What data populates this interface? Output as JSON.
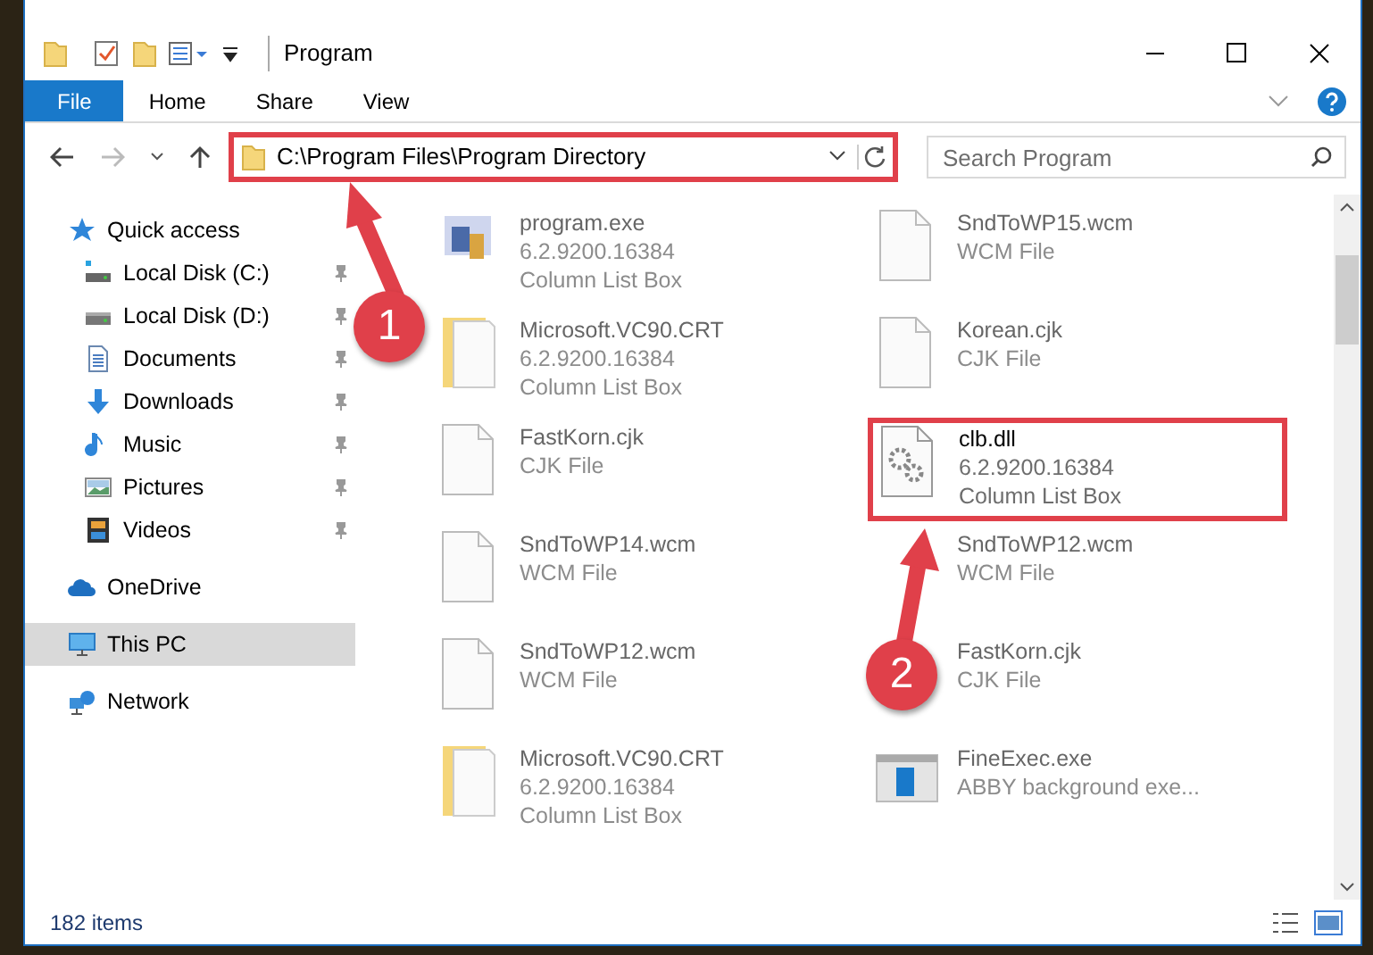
{
  "window": {
    "title": "Program"
  },
  "ribbon_tabs": [
    {
      "label": "File",
      "selected": true
    },
    {
      "label": "Home",
      "selected": false
    },
    {
      "label": "Share",
      "selected": false
    },
    {
      "label": "View",
      "selected": false
    }
  ],
  "address_bar": {
    "path": "C:\\Program Files\\Program Directory",
    "highlighted": true
  },
  "search": {
    "placeholder": "Search Program"
  },
  "sidebar": {
    "items": [
      {
        "label": "Quick access",
        "kind": "quick",
        "selected": false,
        "children": [
          {
            "label": "Local Disk (C:)",
            "kind": "disk-c",
            "pinned": true,
            "selected": false
          },
          {
            "label": "Local Disk (D:)",
            "kind": "disk",
            "pinned": true,
            "selected": false
          },
          {
            "label": "Documents",
            "kind": "documents",
            "pinned": true,
            "selected": false
          },
          {
            "label": "Downloads",
            "kind": "downloads",
            "pinned": true,
            "selected": false
          },
          {
            "label": "Music",
            "kind": "music",
            "pinned": true,
            "selected": false
          },
          {
            "label": "Pictures",
            "kind": "pictures",
            "pinned": true,
            "selected": false
          },
          {
            "label": "Videos",
            "kind": "videos",
            "pinned": true,
            "selected": false
          }
        ]
      },
      {
        "label": "OneDrive",
        "kind": "cloud",
        "selected": false
      },
      {
        "label": "This PC",
        "kind": "pc",
        "selected": true
      },
      {
        "label": "Network",
        "kind": "network",
        "selected": false
      }
    ]
  },
  "files": [
    {
      "name": "program.exe",
      "lines": [
        "6.2.9200.16384",
        "Column List Box"
      ],
      "kind": "exe",
      "blurred": true,
      "highlighted": false
    },
    {
      "name": "SndToWP15.wcm",
      "lines": [
        "WCM File"
      ],
      "kind": "file",
      "blurred": true,
      "highlighted": false
    },
    {
      "name": "Microsoft.VC90.CRT",
      "lines": [
        "6.2.9200.16384",
        "Column List Box"
      ],
      "kind": "manifest",
      "blurred": true,
      "highlighted": false
    },
    {
      "name": "Korean.cjk",
      "lines": [
        "CJK File"
      ],
      "kind": "file",
      "blurred": true,
      "highlighted": false
    },
    {
      "name": "FastKorn.cjk",
      "lines": [
        "CJK File"
      ],
      "kind": "file",
      "blurred": true,
      "highlighted": false
    },
    {
      "name": "clb.dll",
      "lines": [
        "6.2.9200.16384",
        "Column List Box"
      ],
      "kind": "dll",
      "blurred": false,
      "highlighted": true
    },
    {
      "name": "SndToWP14.wcm",
      "lines": [
        "WCM File"
      ],
      "kind": "file",
      "blurred": true,
      "highlighted": false
    },
    {
      "name": "SndToWP12.wcm",
      "lines": [
        "WCM File"
      ],
      "kind": "covered",
      "blurred": true,
      "highlighted": false
    },
    {
      "name": "SndToWP12.wcm",
      "lines": [
        "WCM File"
      ],
      "kind": "file",
      "blurred": true,
      "highlighted": false
    },
    {
      "name": "FastKorn.cjk",
      "lines": [
        "CJK File"
      ],
      "kind": "covered",
      "blurred": true,
      "highlighted": false
    },
    {
      "name": "Microsoft.VC90.CRT",
      "lines": [
        "6.2.9200.16384",
        "Column List Box"
      ],
      "kind": "manifest",
      "blurred": true,
      "highlighted": false
    },
    {
      "name": "FineExec.exe",
      "lines": [
        "ABBY background exe..."
      ],
      "kind": "app",
      "blurred": true,
      "highlighted": false
    }
  ],
  "status_bar": {
    "text": "182 items"
  },
  "annotations": [
    {
      "number": "1"
    },
    {
      "number": "2"
    }
  ]
}
